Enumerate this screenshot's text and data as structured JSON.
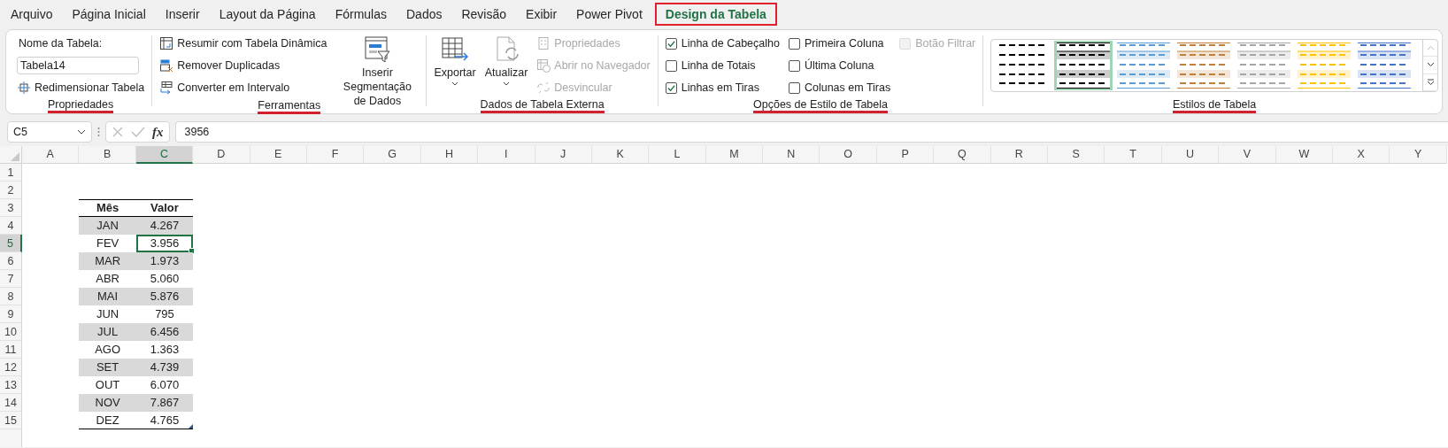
{
  "menu_tabs": [
    {
      "label": "Arquivo",
      "selected": false
    },
    {
      "label": "Página Inicial",
      "selected": false
    },
    {
      "label": "Inserir",
      "selected": false
    },
    {
      "label": "Layout da Página",
      "selected": false
    },
    {
      "label": "Fórmulas",
      "selected": false
    },
    {
      "label": "Dados",
      "selected": false
    },
    {
      "label": "Revisão",
      "selected": false
    },
    {
      "label": "Exibir",
      "selected": false
    },
    {
      "label": "Power Pivot",
      "selected": false
    },
    {
      "label": "Design da Tabela",
      "selected": true
    }
  ],
  "ribbon_groups": [
    {
      "label": "Propriedades",
      "items": [
        {
          "kind": "label",
          "text": "Nome da Tabela:"
        },
        {
          "kind": "field",
          "value": "Tabela14"
        },
        {
          "kind": "small_button",
          "label": "Redimensionar Tabela",
          "disabled": false
        }
      ]
    },
    {
      "label": "Ferramentas",
      "items": [
        {
          "kind": "small_button",
          "label": "Resumir com Tabela Dinâmica",
          "disabled": false
        },
        {
          "kind": "small_button",
          "label": "Remover Duplicadas",
          "disabled": false
        },
        {
          "kind": "small_button",
          "label": "Converter em Intervalo",
          "disabled": false
        },
        {
          "kind": "large_button",
          "label": "Inserir Segmentação de Dados",
          "dropdown": false,
          "disabled": false
        }
      ]
    },
    {
      "label": "Dados de Tabela Externa",
      "items": [
        {
          "kind": "large_button",
          "label": "Exportar",
          "dropdown": true,
          "disabled": false
        },
        {
          "kind": "large_button",
          "label": "Atualizar",
          "dropdown": true,
          "disabled": false
        },
        {
          "kind": "small_button",
          "label": "Propriedades",
          "disabled": true
        },
        {
          "kind": "small_button",
          "label": "Abrir no Navegador",
          "disabled": true
        },
        {
          "kind": "small_button",
          "label": "Desvincular",
          "disabled": true
        }
      ]
    },
    {
      "label": "Opções de Estilo de Tabela",
      "items": [
        {
          "kind": "checkbox",
          "label": "Linha de Cabeçalho",
          "checked": true,
          "disabled": false
        },
        {
          "kind": "checkbox",
          "label": "Linha de Totais",
          "checked": false,
          "disabled": false
        },
        {
          "kind": "checkbox",
          "label": "Linhas em Tiras",
          "checked": true,
          "disabled": false
        },
        {
          "kind": "checkbox",
          "label": "Primeira Coluna",
          "checked": false,
          "disabled": false
        },
        {
          "kind": "checkbox",
          "label": "Última Coluna",
          "checked": false,
          "disabled": false
        },
        {
          "kind": "checkbox",
          "label": "Colunas em Tiras",
          "checked": false,
          "disabled": false
        },
        {
          "kind": "checkbox",
          "label": "Botão Filtrar",
          "checked": false,
          "disabled": true
        }
      ]
    },
    {
      "label": "Estilos de Tabela",
      "items": [
        {
          "kind": "gallery",
          "styles": [
            {
              "kind": "plain",
              "color": "#000000",
              "selected": false
            },
            {
              "kind": "banded",
              "color": "#000000",
              "selected": true
            },
            {
              "kind": "banded",
              "color": "#5b9bd5",
              "selected": false
            },
            {
              "kind": "banded",
              "color": "#c0803a",
              "selected": false
            },
            {
              "kind": "banded",
              "color": "#a5a5a5",
              "selected": false
            },
            {
              "kind": "banded",
              "color": "#ffc000",
              "selected": false
            },
            {
              "kind": "banded",
              "color": "#4472c4",
              "selected": false
            }
          ]
        }
      ]
    }
  ],
  "formula_bar": {
    "name_box": "C5",
    "function_label": "fx",
    "formula": "3956"
  },
  "sheet": {
    "columns": [
      {
        "label": "A",
        "selected": false
      },
      {
        "label": "B",
        "selected": false
      },
      {
        "label": "C",
        "selected": true
      },
      {
        "label": "D",
        "selected": false
      },
      {
        "label": "E",
        "selected": false
      },
      {
        "label": "F",
        "selected": false
      },
      {
        "label": "G",
        "selected": false
      },
      {
        "label": "H",
        "selected": false
      },
      {
        "label": "I",
        "selected": false
      },
      {
        "label": "J",
        "selected": false
      },
      {
        "label": "K",
        "selected": false
      },
      {
        "label": "L",
        "selected": false
      },
      {
        "label": "M",
        "selected": false
      },
      {
        "label": "N",
        "selected": false
      },
      {
        "label": "O",
        "selected": false
      },
      {
        "label": "P",
        "selected": false
      },
      {
        "label": "Q",
        "selected": false
      },
      {
        "label": "R",
        "selected": false
      },
      {
        "label": "S",
        "selected": false
      },
      {
        "label": "T",
        "selected": false
      },
      {
        "label": "U",
        "selected": false
      },
      {
        "label": "V",
        "selected": false
      },
      {
        "label": "W",
        "selected": false
      },
      {
        "label": "X",
        "selected": false
      },
      {
        "label": "Y",
        "selected": false
      }
    ],
    "rows": [
      {
        "label": "1",
        "selected": false
      },
      {
        "label": "2",
        "selected": false
      },
      {
        "label": "3",
        "selected": false
      },
      {
        "label": "4",
        "selected": false
      },
      {
        "label": "5",
        "selected": true
      },
      {
        "label": "6",
        "selected": false
      },
      {
        "label": "7",
        "selected": false
      },
      {
        "label": "8",
        "selected": false
      },
      {
        "label": "9",
        "selected": false
      },
      {
        "label": "10",
        "selected": false
      },
      {
        "label": "11",
        "selected": false
      },
      {
        "label": "12",
        "selected": false
      },
      {
        "label": "13",
        "selected": false
      },
      {
        "label": "14",
        "selected": false
      },
      {
        "label": "15",
        "selected": false
      }
    ],
    "table": {
      "banded_rows": true,
      "headers": [
        "Mês",
        "Valor"
      ],
      "rows": [
        {
          "month": "JAN",
          "value": "4.267",
          "selected": false
        },
        {
          "month": "FEV",
          "value": "3.956",
          "selected": true
        },
        {
          "month": "MAR",
          "value": "1.973",
          "selected": false
        },
        {
          "month": "ABR",
          "value": "5.060",
          "selected": false
        },
        {
          "month": "MAI",
          "value": "5.876",
          "selected": false
        },
        {
          "month": "JUN",
          "value": "795",
          "selected": false
        },
        {
          "month": "JUL",
          "value": "6.456",
          "selected": false
        },
        {
          "month": "AGO",
          "value": "1.363",
          "selected": false
        },
        {
          "month": "SET",
          "value": "4.739",
          "selected": false
        },
        {
          "month": "OUT",
          "value": "6.070",
          "selected": false
        },
        {
          "month": "NOV",
          "value": "7.867",
          "selected": false
        },
        {
          "month": "DEZ",
          "value": "4.765",
          "selected": false
        }
      ]
    }
  }
}
